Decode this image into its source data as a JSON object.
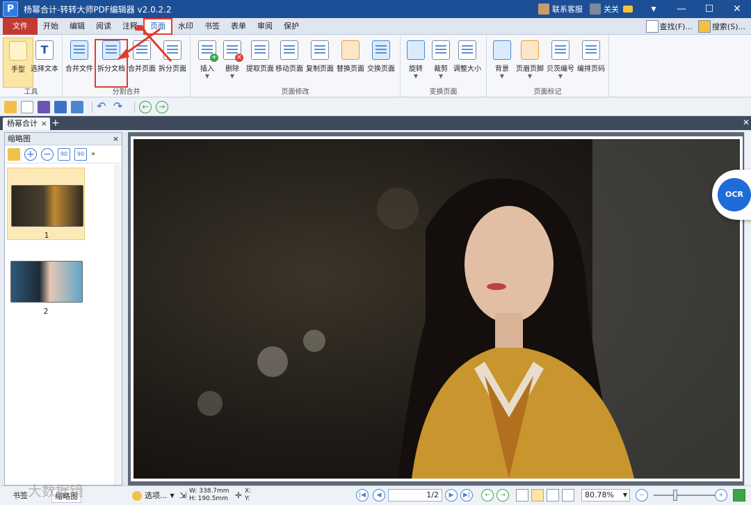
{
  "window": {
    "title": "杨幂合计-转转大师PDF编辑器 v2.0.2.2",
    "logo_letter": "P",
    "contact": "联系客服",
    "user": "关关",
    "minimize": "—",
    "maximize": "☐",
    "close": "✕",
    "menu_icon": "▾"
  },
  "menu": {
    "file": "文件",
    "items": [
      "开始",
      "编辑",
      "阅读",
      "注释",
      "页面",
      "水印",
      "书签",
      "表单",
      "审阅",
      "保护"
    ],
    "active": "页面",
    "find": "查找(F)...",
    "search": "搜索(S)..."
  },
  "ribbon": {
    "groups": [
      {
        "label": "工具",
        "buttons": [
          {
            "label": "手型",
            "icon": "hand-icon"
          },
          {
            "label": "选择文本",
            "icon": "text-select-icon"
          }
        ]
      },
      {
        "label": "分割合并",
        "buttons": [
          {
            "label": "合并文件",
            "icon": "merge-file-icon"
          },
          {
            "label": "拆分文档",
            "icon": "split-doc-icon"
          },
          {
            "label": "合并页面",
            "icon": "merge-page-icon"
          },
          {
            "label": "拆分页面",
            "icon": "split-page-icon"
          }
        ]
      },
      {
        "label": "页面修改",
        "buttons": [
          {
            "label": "插入",
            "icon": "insert-icon"
          },
          {
            "label": "删除",
            "icon": "delete-icon"
          },
          {
            "label": "提取页面",
            "icon": "extract-icon"
          },
          {
            "label": "移动页面",
            "icon": "move-icon"
          },
          {
            "label": "复制页面",
            "icon": "copy-icon"
          },
          {
            "label": "替换页面",
            "icon": "replace-icon"
          },
          {
            "label": "交换页面",
            "icon": "swap-icon"
          }
        ]
      },
      {
        "label": "变换页面",
        "buttons": [
          {
            "label": "旋转",
            "icon": "rotate-icon"
          },
          {
            "label": "裁剪",
            "icon": "crop-icon"
          },
          {
            "label": "调整大小",
            "icon": "resize-icon"
          }
        ]
      },
      {
        "label": "页面标记",
        "buttons": [
          {
            "label": "背景",
            "icon": "background-icon"
          },
          {
            "label": "页眉页脚",
            "icon": "header-footer-icon"
          },
          {
            "label": "贝茨编号",
            "icon": "bates-icon"
          },
          {
            "label": "编排页码",
            "icon": "page-number-icon"
          }
        ]
      }
    ]
  },
  "tab": {
    "name": "杨幂合计",
    "close": "×",
    "add": "+"
  },
  "thumbnails": {
    "title": "缩略图",
    "close": "×",
    "pages": [
      "1",
      "2"
    ]
  },
  "ocr": "OCR",
  "status": {
    "tab1": "书签",
    "tab2": "缩略图",
    "options": "选项...",
    "width": "W: 338.7mm",
    "height": "H: 190.5mm",
    "x": "X:",
    "y": "Y:",
    "page": "1/2",
    "zoom": "80.78%"
  },
  "watermark": "大数据镜"
}
